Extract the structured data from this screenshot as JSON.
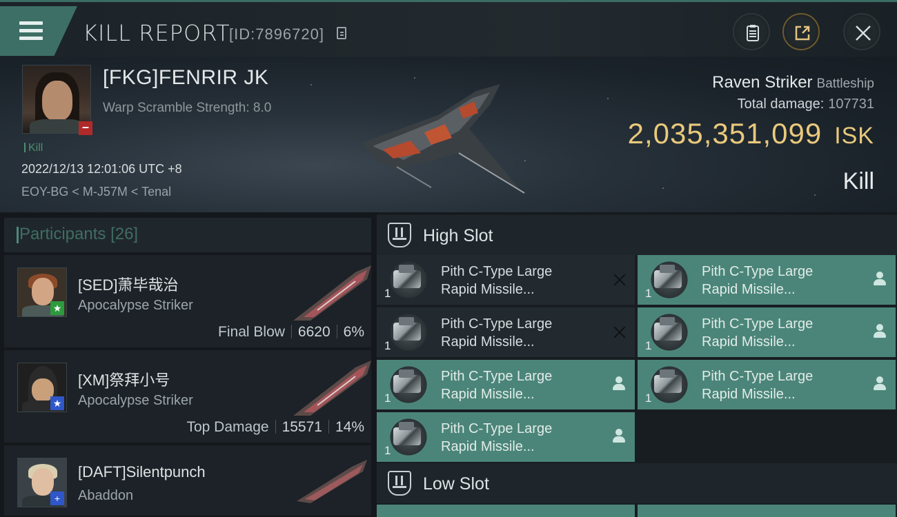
{
  "header": {
    "title": "KILL REPORT",
    "report_id": "[ID:7896720]"
  },
  "victim": {
    "name": "[FKG]FENRIR JK",
    "warp_scramble": "Warp Scramble Strength: 8.0",
    "kill_tag": "Kill",
    "timestamp": "2022/12/13 12:01:06 UTC +8",
    "location": "EOY-BG < M-J57M < Tenal",
    "ship_name": "Raven Striker",
    "ship_class": "Battleship",
    "total_damage_label": "Total damage:",
    "total_damage": "107731",
    "isk_value": "2,035,351,099",
    "isk_unit": "ISK",
    "result": "Kill"
  },
  "participants": {
    "label": "Participants",
    "count": "[26]",
    "rows": [
      {
        "name": "[SED]萧毕哉治",
        "ship": "Apocalypse Striker",
        "role": "Final Blow",
        "damage": "6620",
        "percent": "6%",
        "badge": "★",
        "badge_color": "#2e9a3e"
      },
      {
        "name": "[XM]祭拜小号",
        "ship": "Apocalypse Striker",
        "role": "Top Damage",
        "damage": "15571",
        "percent": "14%",
        "badge": "★",
        "badge_color": "#2f57c9"
      },
      {
        "name": "[DAFT]Silentpunch",
        "ship": "Abaddon",
        "role": "",
        "damage": "",
        "percent": "",
        "badge": "+",
        "badge_color": "#2f57c9"
      }
    ]
  },
  "slots": {
    "high_title": "High Slot",
    "low_title": "Low Slot",
    "items": [
      {
        "line1": "Pith C-Type Large",
        "line2": "Rapid Missile...",
        "qty": "1",
        "state": "destroyed"
      },
      {
        "line1": "Pith C-Type Large",
        "line2": "Rapid Missile...",
        "qty": "1",
        "state": "dropped"
      },
      {
        "line1": "Pith C-Type Large",
        "line2": "Rapid Missile...",
        "qty": "1",
        "state": "destroyed"
      },
      {
        "line1": "Pith C-Type Large",
        "line2": "Rapid Missile...",
        "qty": "1",
        "state": "dropped"
      },
      {
        "line1": "Pith C-Type Large",
        "line2": "Rapid Missile...",
        "qty": "1",
        "state": "dropped"
      },
      {
        "line1": "Pith C-Type Large",
        "line2": "Rapid Missile...",
        "qty": "1",
        "state": "dropped"
      },
      {
        "line1": "Pith C-Type Large",
        "line2": "Rapid Missile...",
        "qty": "1",
        "state": "dropped"
      }
    ]
  },
  "colors": {
    "accent": "#3d6f66",
    "isk": "#e9c97c",
    "fitted": "#4b8579"
  }
}
